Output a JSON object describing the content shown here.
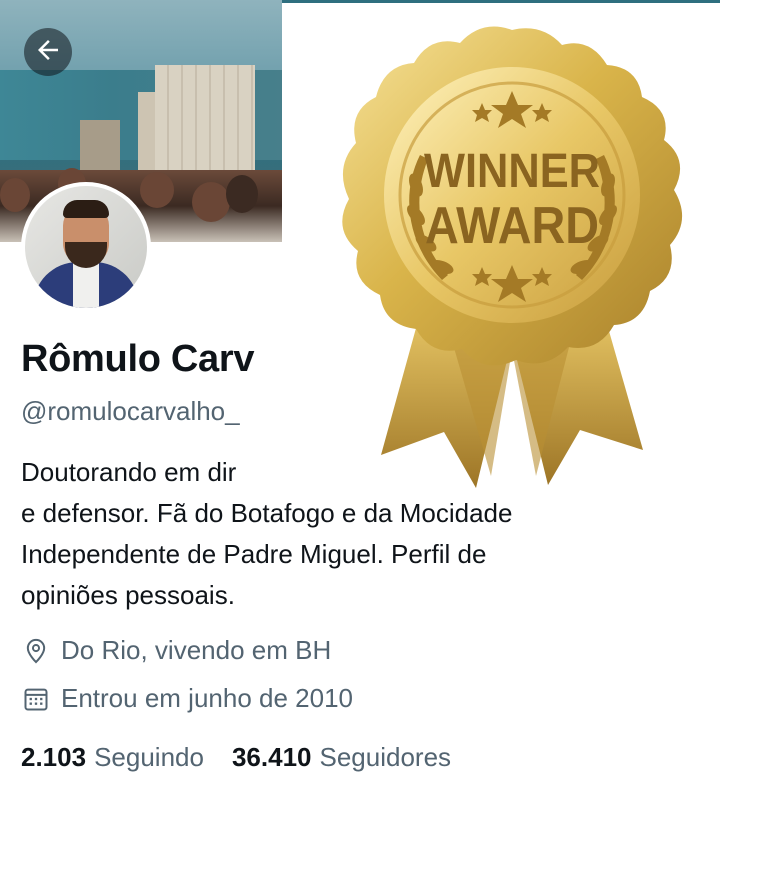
{
  "header": {
    "back_icon": "arrow-left-icon"
  },
  "profile": {
    "name": "Rômulo Carv",
    "handle": "@romulocarvalho_",
    "bio_lines": [
      "Doutorando em dir",
      "e defensor. Fã do Botafogo e da Mocidade",
      "Independente de Padre Miguel. Perfil de",
      "opiniões pessoais."
    ],
    "location": "Do Rio, vivendo em BH",
    "joined": "Entrou em junho de 2010",
    "following_count": "2.103",
    "following_label": "Seguindo",
    "followers_count": "36.410",
    "followers_label": "Seguidores"
  },
  "award": {
    "line1": "WINNER",
    "line2": "AWARD"
  },
  "colors": {
    "text": "#0f1419",
    "secondary": "#536471",
    "gold": "#d9b44a"
  }
}
